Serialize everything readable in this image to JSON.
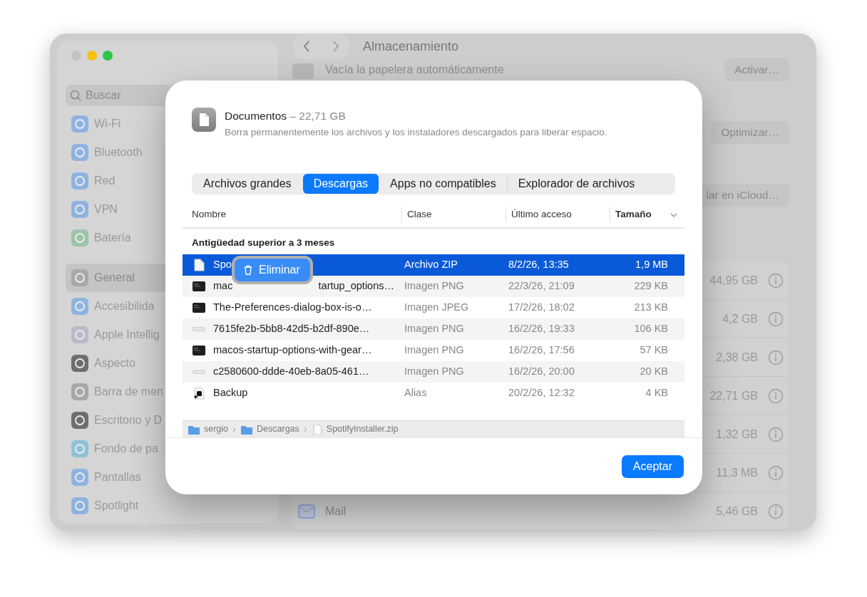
{
  "sidebar": {
    "search": {
      "placeholder": "Buscar"
    },
    "items": [
      {
        "label": "Wi-Fi",
        "selected": false
      },
      {
        "label": "Bluetooth",
        "selected": false
      },
      {
        "label": "Red",
        "selected": false
      },
      {
        "label": "VPN",
        "selected": false
      },
      {
        "label": "Batería",
        "selected": false
      },
      {
        "label": "General",
        "selected": true
      },
      {
        "label": "Accesibilida",
        "selected": false
      },
      {
        "label": "Apple Intellig",
        "selected": false
      },
      {
        "label": "Aspecto",
        "selected": false
      },
      {
        "label": "Barra de men",
        "selected": false
      },
      {
        "label": "Escritorio y D",
        "selected": false
      },
      {
        "label": "Fondo de pa",
        "selected": false
      },
      {
        "label": "Pantallas",
        "selected": false
      },
      {
        "label": "Spotlight",
        "selected": false
      }
    ]
  },
  "toolbar": {
    "title": "Almacenamiento"
  },
  "settings_rows": [
    {
      "label": "Vacía la papelera automáticamente",
      "button": "Activar…"
    },
    {
      "button": "Optimizar…"
    },
    {
      "button": "lar en iCloud…"
    }
  ],
  "storage_rows": [
    {
      "size": "44,95 GB"
    },
    {
      "size": "4,2 GB"
    },
    {
      "size": "2,38 GB"
    },
    {
      "size": "22,71 GB"
    },
    {
      "size": "1,32 GB"
    },
    {
      "size": "11,3 MB"
    },
    {
      "label": "Mail",
      "size": "5,46 GB"
    }
  ],
  "dialog": {
    "title": "Documentos",
    "size": "– 22,71 GB",
    "description": "Borra permanentemente los archivos y los instaladores descargados para liberar espacio.",
    "tabs": [
      {
        "label": "Archivos grandes",
        "selected": false
      },
      {
        "label": "Descargas",
        "selected": true
      },
      {
        "label": "Apps no compatibles",
        "selected": false
      },
      {
        "label": "Explorador de archivos",
        "selected": false
      }
    ],
    "columns": [
      {
        "label": "Nombre",
        "sorted": false
      },
      {
        "label": "Clase",
        "sorted": false
      },
      {
        "label": "Último acceso",
        "sorted": false
      },
      {
        "label": "Tamaño",
        "sorted": true
      }
    ],
    "group": "Antigüedad superior a 3 meses",
    "rows": [
      {
        "kind": "document",
        "name": "Spo",
        "type": "Archivo ZIP",
        "accessed": "8/2/26, 13:35",
        "size": "1,9 MB",
        "selected": true
      },
      {
        "kind": "terminal",
        "name": "mac",
        "name_after_menu": "tartup_options…",
        "type": "Imagen PNG",
        "accessed": "22/3/26, 21:09",
        "size": "229 KB",
        "selected": false
      },
      {
        "kind": "terminal",
        "name": "The-Preferences-dialog-box-is-o…",
        "type": "Imagen JPEG",
        "accessed": "17/2/26, 18:02",
        "size": "213 KB",
        "selected": false
      },
      {
        "kind": "banner",
        "name": "7615fe2b-5bb8-42d5-b2df-890e…",
        "type": "Imagen PNG",
        "accessed": "16/2/26, 19:33",
        "size": "106 KB",
        "selected": false
      },
      {
        "kind": "terminal",
        "name": "macos-startup-options-with-gear…",
        "type": "Imagen PNG",
        "accessed": "16/2/26, 17:56",
        "size": "57 KB",
        "selected": false
      },
      {
        "kind": "banner",
        "name": "c2580600-ddde-40eb-8a05-461…",
        "type": "Imagen PNG",
        "accessed": "16/2/26, 20:00",
        "size": "20 KB",
        "selected": false
      },
      {
        "kind": "alias",
        "name": "Backup",
        "type": "Alias",
        "accessed": "20/2/26, 12:32",
        "size": "4 KB",
        "selected": false
      }
    ],
    "context_menu": {
      "label": "Eliminar"
    },
    "path": [
      {
        "kind": "folder",
        "label": "sergio"
      },
      {
        "kind": "folder",
        "label": "Descargas"
      },
      {
        "kind": "file",
        "label": "SpotifyInstaller.zip"
      }
    ],
    "ok_button": "Aceptar"
  }
}
